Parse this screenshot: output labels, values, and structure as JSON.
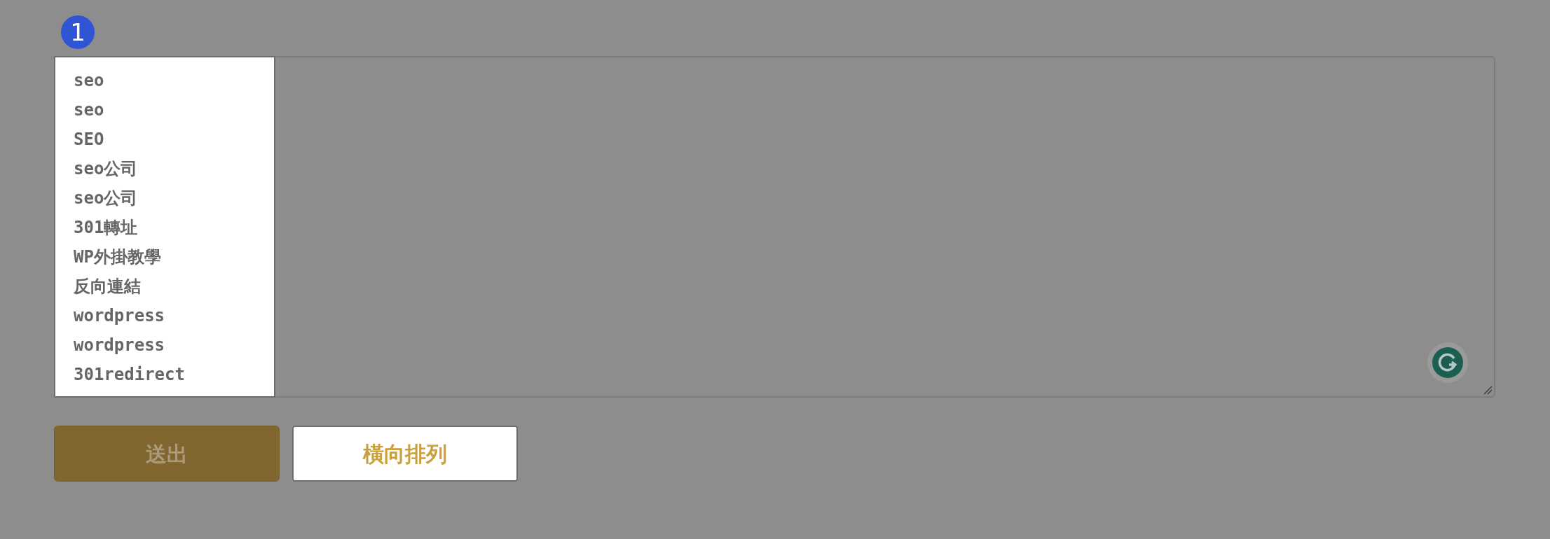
{
  "step_badge": "1",
  "suggestions": [
    "seo",
    "seo",
    "SEO",
    "seo公司",
    "seo公司",
    "301轉址",
    "WP外掛教學",
    "反向連結",
    "wordpress",
    "wordpress",
    "301redirect"
  ],
  "buttons": [
    {
      "label": "送出",
      "kind": "primary"
    },
    {
      "label": "橫向排列",
      "kind": "outline"
    }
  ]
}
